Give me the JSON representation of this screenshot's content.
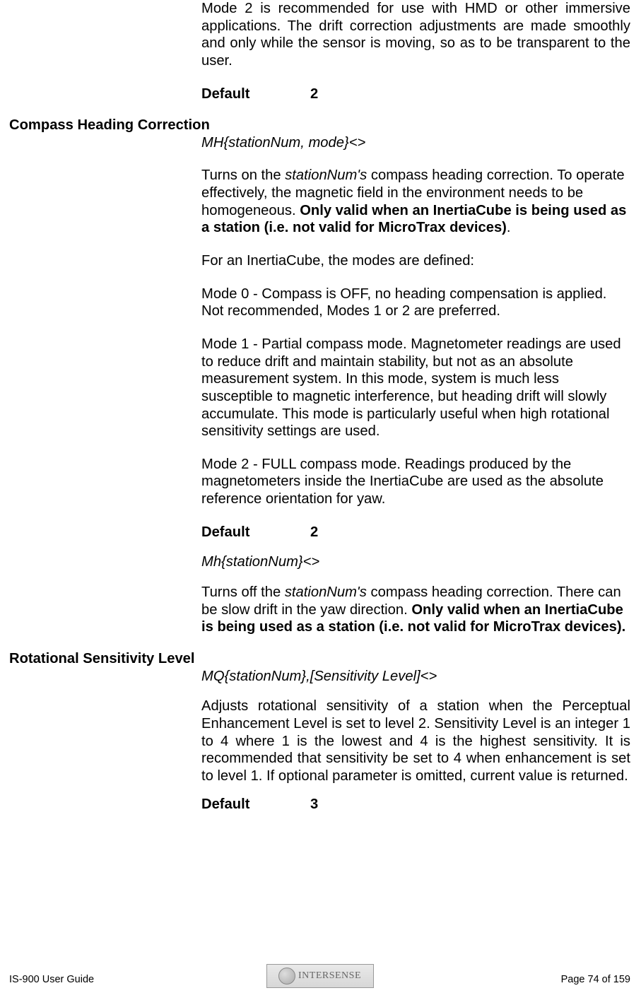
{
  "intro": {
    "p1": "Mode 2 is recommended for use with HMD or other immersive applications.  The drift correction adjustments are made smoothly and only while the sensor is moving, so as to be transparent to the user.",
    "default_label": "Default",
    "default_value": "2"
  },
  "compass": {
    "heading": "Compass Heading Correction",
    "syntax1": "MH{stationNum, mode}<>",
    "p1_a": "Turns on the ",
    "p1_b_italic": "stationNum's",
    "p1_c": " compass heading correction.  To operate effectively, the magnetic field in the environment needs to be homogeneous.  ",
    "p1_d_bold": "Only valid when an InertiaCube is being used as a station (i.e. not valid for MicroTrax devices)",
    "p1_e": ".",
    "p2": "For an InertiaCube, the modes are defined:",
    "mode0": "Mode 0 - Compass is OFF, no heading compensation is applied.  Not recommended, Modes 1 or 2 are preferred.",
    "mode1": "Mode 1 - Partial compass mode.  Magnetometer readings are used to reduce drift and maintain stability, but not as an absolute measurement system.  In this mode, system is much less susceptible to magnetic interference, but heading drift will slowly accumulate.  This mode is particularly useful when high rotational sensitivity settings are used.",
    "mode2": "Mode 2 - FULL compass mode.  Readings produced by the magnetometers inside the InertiaCube are used as the absolute reference orientation for yaw.",
    "default_label": "Default",
    "default_value": "2",
    "syntax2": "Mh{stationNum}<>",
    "p3_a": "Turns off the ",
    "p3_b_italic": "stationNum's",
    "p3_c": " compass heading correction.  There can be slow drift in the yaw direction.  ",
    "p3_d_bold": "Only valid when an InertiaCube is being used as a station (i.e. not valid for MicroTrax devices)."
  },
  "rotational": {
    "heading": "Rotational Sensitivity Level",
    "syntax": "MQ{stationNum},[Sensitivity Level]<>",
    "p1": "Adjusts rotational sensitivity of a station when the Perceptual Enhancement Level is set to level 2.  Sensitivity Level is an integer 1 to 4 where 1 is the lowest and 4 is the highest sensitivity.  It is recommended that sensitivity be set to 4 when enhancement is set to level 1. If optional parameter is omitted, current value is returned.",
    "default_label": "Default",
    "default_value": "3"
  },
  "footer": {
    "left": "IS-900 User Guide",
    "right": "Page 74 of 159",
    "logo_text": "INTERSENSE"
  }
}
